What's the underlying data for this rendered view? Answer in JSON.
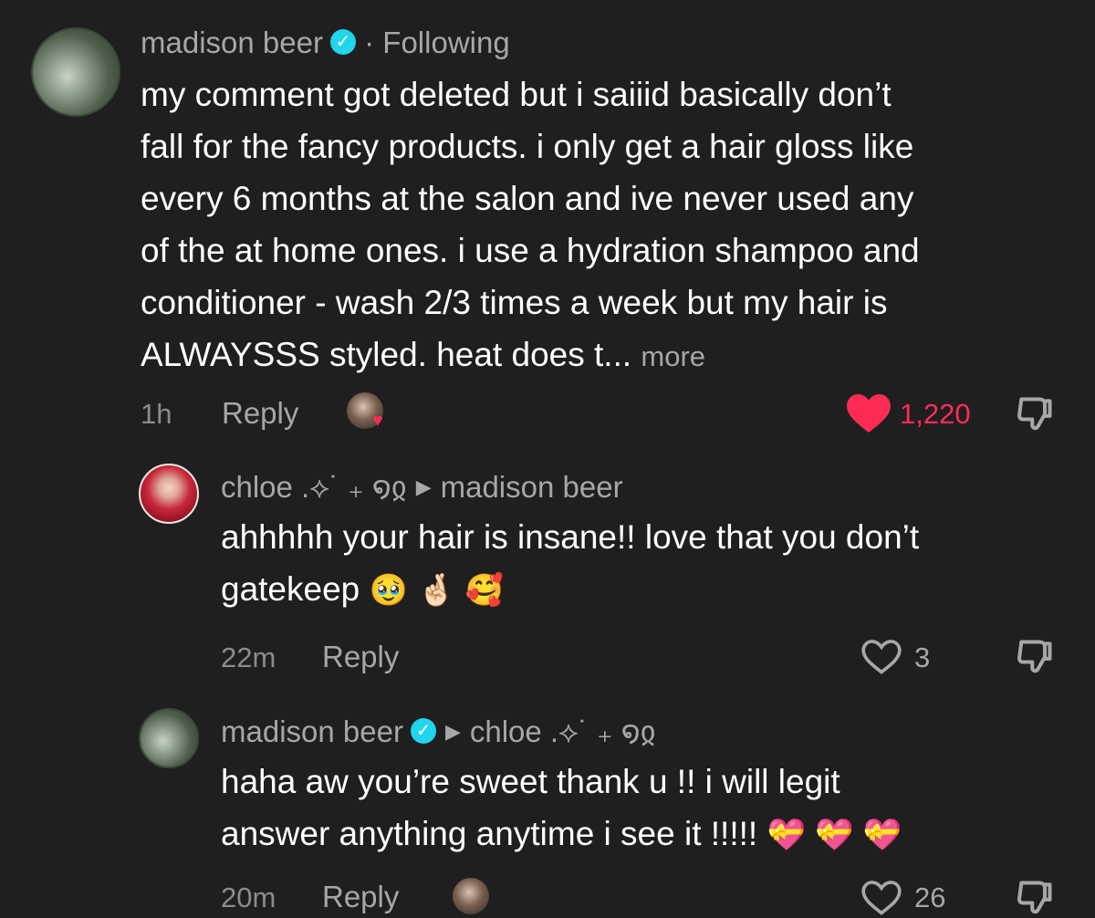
{
  "comments": [
    {
      "author": "madison beer",
      "separator": "·",
      "status": "Following",
      "lines": [
        "my comment got deleted but i saiiid basically don’t",
        "fall for the fancy products. i only get a hair gloss like",
        "every 6 months at the salon and ive never used any",
        "of the at home ones. i use a hydration shampoo and",
        "conditioner - wash 2/3 times a week but my hair is",
        "ALWAYSSS styled. heat does t..."
      ],
      "more_label": "more",
      "time": "1h",
      "reply_label": "Reply",
      "like_count": "1,220",
      "liked": true,
      "colors": {
        "liked": "#fe2c55",
        "verified": "#20d5ec"
      },
      "icons": {
        "like": "heart-filled-icon",
        "dislike": "thumbs-down-icon",
        "verified": "verified-badge-icon"
      }
    },
    {
      "author": "chloe .⟡˙ ₊ ໑ჲ",
      "reply_to": "madison beer",
      "lines": [
        "ahhhhh your hair is insane!! love that you don’t",
        "gatekeep"
      ],
      "emojis": [
        "🥹",
        "🤞🏻",
        "🥰"
      ],
      "time": "22m",
      "reply_label": "Reply",
      "like_count": "3",
      "liked": false,
      "icons": {
        "like": "heart-outline-icon",
        "dislike": "thumbs-down-icon"
      }
    },
    {
      "author": "madison beer",
      "reply_to": "chloe .⟡˙ ₊ ໑ჲ",
      "lines": [
        "haha aw you’re sweet thank u !! i will legit",
        "answer anything anytime i see it !!!!!"
      ],
      "emojis": [
        "💝",
        "💝",
        "💝"
      ],
      "time": "20m",
      "reply_label": "Reply",
      "like_count": "26",
      "liked": false
    }
  ]
}
